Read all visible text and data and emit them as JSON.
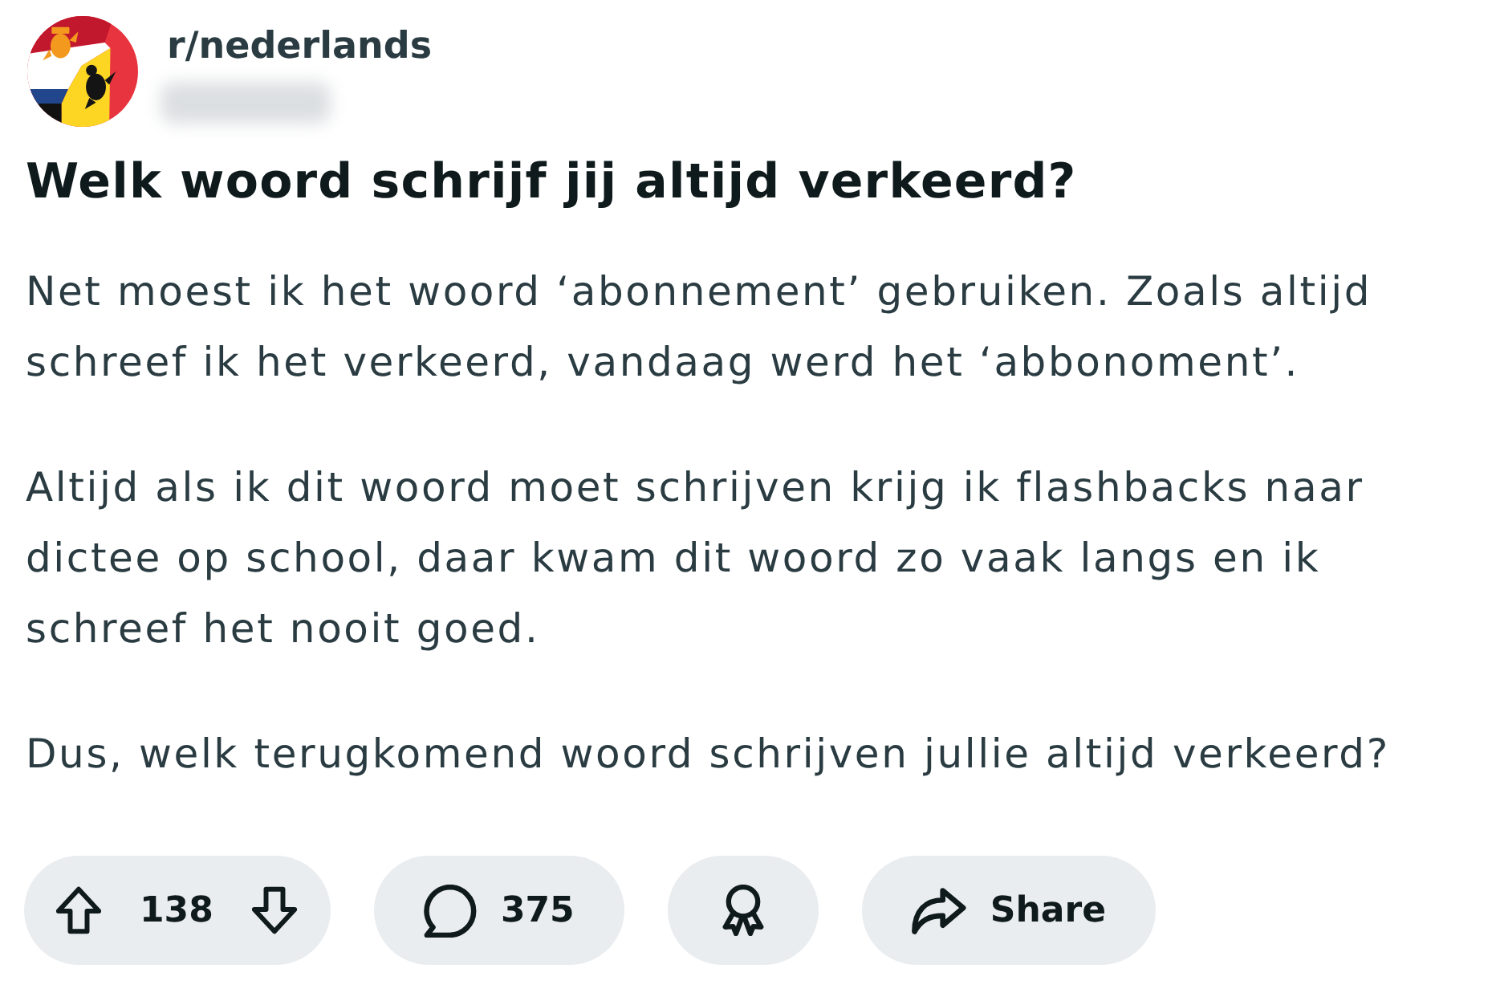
{
  "post": {
    "subreddit": "r/nederlands",
    "author_redacted": true,
    "title": "Welk woord schrijf jij altijd verkeerd?",
    "body": [
      "Net moest ik het woord ‘abonnement’ gebruiken. Zoals altijd schreef ik het verkeerd, vandaag werd het ‘abbonoment’.",
      "Altijd als ik dit woord moet schrijven krijg ik flashbacks naar dictee op school, daar kwam dit woord zo vaak langs en ik schreef het nooit goed.",
      "Dus, welk terugkomend woord schrijven jullie altijd verkeerd?"
    ]
  },
  "actions": [
    {
      "kind": "vote",
      "count": "138"
    },
    {
      "kind": "comments",
      "count": "375"
    },
    {
      "kind": "award"
    },
    {
      "kind": "share",
      "label": "Share"
    }
  ]
}
